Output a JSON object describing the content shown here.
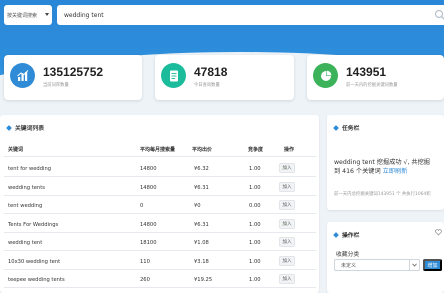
{
  "search": {
    "mode": "按关键词搜索",
    "query": "wedding tent"
  },
  "stats": [
    {
      "value": "135125752",
      "label": "当前词库数量",
      "icon": "chart-icon",
      "color": "#2f8bd6"
    },
    {
      "value": "47818",
      "label": "今日查询数量",
      "icon": "document-icon",
      "color": "#1bbc9b"
    },
    {
      "value": "143951",
      "label": "前一天内的挖掘关键词数量",
      "icon": "pie-chart-icon",
      "color": "#3cb35b"
    }
  ],
  "keywords": {
    "title": "关键词列表",
    "headers": [
      "关键词",
      "平均每月搜索量",
      "平均出价",
      "竞争度",
      "操作"
    ],
    "add_label": "加入",
    "rows": [
      [
        "tent for wedding",
        "14800",
        "¥6.32",
        "1.00"
      ],
      [
        "wedding tents",
        "14800",
        "¥6.31",
        "1.00"
      ],
      [
        "tent wedding",
        "0",
        "¥0",
        "0.00"
      ],
      [
        "Tents For Weddings",
        "14800",
        "¥6.31",
        "1.00"
      ],
      [
        "wedding tent",
        "18100",
        "¥1.08",
        "1.00"
      ],
      [
        "10x30 wedding tent",
        "110",
        "¥3.18",
        "1.00"
      ],
      [
        "teepee wedding tents",
        "260",
        "¥19.25",
        "1.00"
      ]
    ]
  },
  "tasks": {
    "title": "任务栏",
    "line1": "wedding tent 挖掘成功 √, 共挖掘",
    "line2_prefix": "到 416 个关键词 ",
    "update_link": "立即刷新",
    "note": "前一天内总挖掘关键词143951 个 共执行1064积"
  },
  "actions": {
    "title": "操作栏",
    "favorite_label": "收藏分类",
    "category_selected": "未定义",
    "favorite_button": "增加"
  }
}
